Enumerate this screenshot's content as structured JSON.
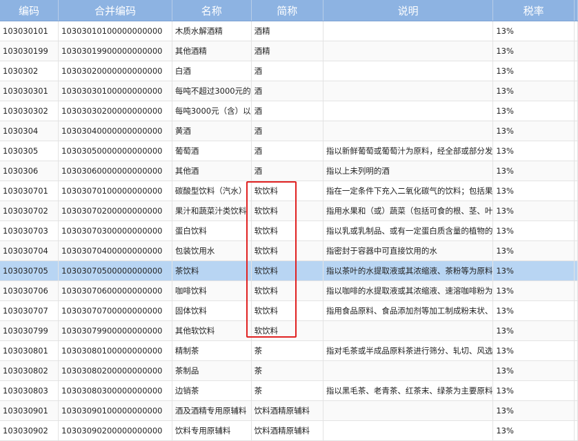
{
  "columns": [
    "编码",
    "合并编码",
    "名称",
    "简称",
    "说明",
    "税率"
  ],
  "rows": [
    {
      "code": "103030101",
      "merged_code": "10303010100000000000",
      "name": "木质水解酒精",
      "short": "酒精",
      "desc": "",
      "rate": "13%"
    },
    {
      "code": "103030199",
      "merged_code": "10303019900000000000",
      "name": "其他酒精",
      "short": "酒精",
      "desc": "",
      "rate": "13%"
    },
    {
      "code": "1030302",
      "merged_code": "10303020000000000000",
      "name": "白酒",
      "short": "酒",
      "desc": "",
      "rate": "13%"
    },
    {
      "code": "103030301",
      "merged_code": "10303030100000000000",
      "name": "每吨不超过3000元的",
      "short": "酒",
      "desc": "",
      "rate": "13%"
    },
    {
      "code": "103030302",
      "merged_code": "10303030200000000000",
      "name": "每吨3000元（含）以",
      "short": "酒",
      "desc": "",
      "rate": "13%"
    },
    {
      "code": "1030304",
      "merged_code": "10303040000000000000",
      "name": "黄酒",
      "short": "酒",
      "desc": "",
      "rate": "13%"
    },
    {
      "code": "1030305",
      "merged_code": "10303050000000000000",
      "name": "葡萄酒",
      "short": "酒",
      "desc": "指以新鲜葡萄或葡萄汁为原料，经全部或部分发",
      "rate": "13%"
    },
    {
      "code": "1030306",
      "merged_code": "10303060000000000000",
      "name": "其他酒",
      "short": "酒",
      "desc": "指以上未列明的酒",
      "rate": "13%"
    },
    {
      "code": "103030701",
      "merged_code": "10303070100000000000",
      "name": "碳酸型饮料（汽水）",
      "short": "软饮料",
      "desc": "指在一定条件下充入二氧化碳气的饮料；包括果",
      "rate": "13%"
    },
    {
      "code": "103030702",
      "merged_code": "10303070200000000000",
      "name": "果汁和蔬菜汁类饮料",
      "short": "软饮料",
      "desc": "指用水果和（或）蔬菜（包括可食的根、茎、叶",
      "rate": "13%"
    },
    {
      "code": "103030703",
      "merged_code": "10303070300000000000",
      "name": "蛋白饮料",
      "short": "软饮料",
      "desc": "指以乳或乳制品、或有一定蛋白质含量的植物的",
      "rate": "13%"
    },
    {
      "code": "103030704",
      "merged_code": "10303070400000000000",
      "name": "包装饮用水",
      "short": "软饮料",
      "desc": "指密封于容器中可直接饮用的水",
      "rate": "13%"
    },
    {
      "code": "103030705",
      "merged_code": "10303070500000000000",
      "name": "茶饮料",
      "short": "软饮料",
      "desc": "指以茶叶的水提取液或其浓缩液、茶粉等为原料",
      "rate": "13%"
    },
    {
      "code": "103030706",
      "merged_code": "10303070600000000000",
      "name": "咖啡饮料",
      "short": "软饮料",
      "desc": "指以咖啡的水提取液或其浓缩液、速溶咖啡粉为",
      "rate": "13%"
    },
    {
      "code": "103030707",
      "merged_code": "10303070700000000000",
      "name": "固体饮料",
      "short": "软饮料",
      "desc": "指用食品原料、食品添加剂等加工制成粉末状、",
      "rate": "13%"
    },
    {
      "code": "103030799",
      "merged_code": "10303079900000000000",
      "name": "其他软饮料",
      "short": "软饮料",
      "desc": "",
      "rate": "13%"
    },
    {
      "code": "103030801",
      "merged_code": "10303080100000000000",
      "name": "精制茶",
      "short": "茶",
      "desc": "指对毛茶或半成品原料茶进行筛分、轧切、风选",
      "rate": "13%"
    },
    {
      "code": "103030802",
      "merged_code": "10303080200000000000",
      "name": "茶制品",
      "short": "茶",
      "desc": "",
      "rate": "13%"
    },
    {
      "code": "103030803",
      "merged_code": "10303080300000000000",
      "name": "边销茶",
      "short": "茶",
      "desc": "指以黑毛茶、老青茶、红茶末、绿茶为主要原料",
      "rate": "13%"
    },
    {
      "code": "103030901",
      "merged_code": "10303090100000000000",
      "name": "酒及酒精专用原辅料",
      "short": "饮料酒精原辅料",
      "desc": "",
      "rate": "13%"
    },
    {
      "code": "103030902",
      "merged_code": "10303090200000000000",
      "name": "饮料专用原辅料",
      "short": "饮料酒精原辅料",
      "desc": "",
      "rate": "13%"
    }
  ],
  "selected_row_index": 12,
  "highlight_color": "#e02020",
  "header_color": "#8db3e2",
  "selected_color": "#b8d5f3"
}
